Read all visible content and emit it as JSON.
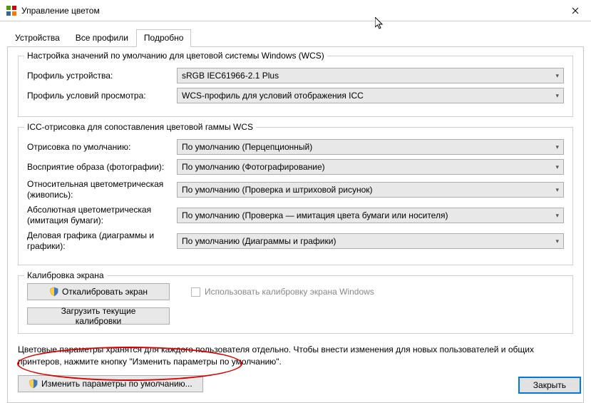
{
  "window": {
    "title": "Управление цветом"
  },
  "tabs": {
    "devices": "Устройства",
    "allProfiles": "Все профили",
    "advanced": "Подробно"
  },
  "group1": {
    "legend": "Настройка значений по умолчанию для цветовой системы Windows (WCS)",
    "deviceProfileLabel": "Профиль устройства:",
    "deviceProfileValue": "sRGB IEC61966-2.1 Plus",
    "viewingLabel": "Профиль условий просмотра:",
    "viewingValue": "WCS-профиль для условий отображения ICC"
  },
  "group2": {
    "legend": "ICC-отрисовка для сопоставления цветовой гаммы WCS",
    "defaultRenderLabel": "Отрисовка по умолчанию:",
    "defaultRenderValue": "По умолчанию (Перцепционный)",
    "perceptualLabel": "Восприятие образа (фотографии):",
    "perceptualValue": "По умолчанию (Фотографирование)",
    "relColLabel": "Относительная цветометрическая (живопись):",
    "relColValue": "По умолчанию (Проверка и штриховой рисунок)",
    "absColLabel": "Абсолютная цветометрическая (имитация бумаги):",
    "absColValue": "По умолчанию (Проверка — имитация цвета бумаги или носителя)",
    "businessLabel": "Деловая графика (диаграммы и графики):",
    "businessValue": "По умолчанию (Диаграммы и графики)"
  },
  "group3": {
    "legend": "Калибровка экрана",
    "calibrateBtn": "Откалибровать экран",
    "useCalibration": "Использовать калибровку экрана Windows",
    "loadBtn": "Загрузить текущие калибровки"
  },
  "desc": "Цветовые параметры хранятся для каждого пользователя отдельно. Чтобы внести изменения для новых пользователей и общих принтеров, нажмите кнопку \"Изменить параметры по умолчанию\".",
  "changeDefaultsBtn": "Изменить параметры по умолчанию...",
  "closeBtn": "Закрыть"
}
